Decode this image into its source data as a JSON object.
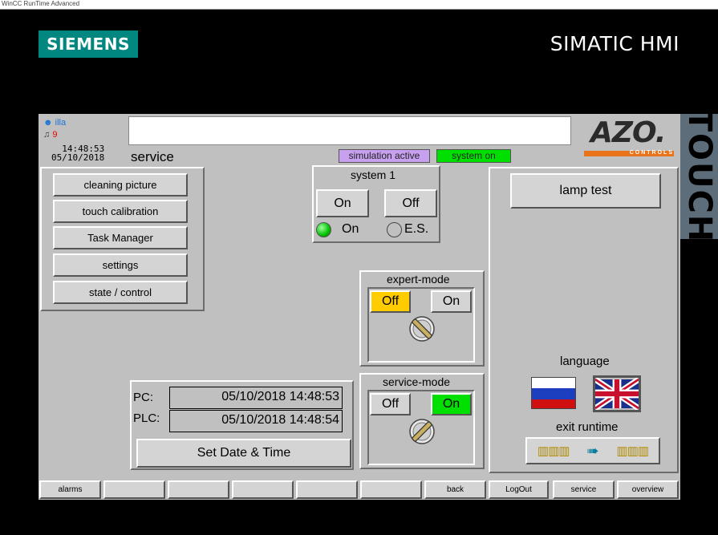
{
  "window": {
    "title_strip": "WinCC RunTime Advanced"
  },
  "brand": {
    "left_logo": "SIEMENS",
    "right_title": "SIMATIC HMI",
    "side_tab": "TOUCH"
  },
  "header": {
    "user": "illa",
    "alarm_count": "9",
    "time": "14:48:53",
    "date": "05/10/2018",
    "page_title": "service",
    "status_simulation": "simulation active",
    "status_system": "system on",
    "logo_text": "AZO.",
    "logo_sub": "CONTROLS"
  },
  "menu": {
    "items": [
      "cleaning picture",
      "touch calibration",
      "Task Manager",
      "settings",
      "state / control"
    ]
  },
  "system": {
    "title": "system 1",
    "on_label": "On",
    "off_label": "Off",
    "status_on": "On",
    "status_es": "E.S."
  },
  "expert_mode": {
    "title": "expert-mode",
    "off_label": "Off",
    "on_label": "On"
  },
  "service_mode": {
    "title": "service-mode",
    "off_label": "Off",
    "on_label": "On"
  },
  "datetime": {
    "pc_label": "PC:",
    "pc_value": "05/10/2018 14:48:53",
    "plc_label": "PLC:",
    "plc_value": "05/10/2018 14:48:54",
    "set_button": "Set Date & Time"
  },
  "right_panel": {
    "lamp_test": "lamp test",
    "language_label": "language",
    "exit_label": "exit runtime"
  },
  "bottom_nav": [
    "alarms",
    "",
    "",
    "",
    "",
    "",
    "back",
    "LogOut",
    "service",
    "overview"
  ],
  "colors": {
    "siemens_teal": "#00877f",
    "status_purple": "#c8a0f0",
    "status_green": "#00e000",
    "active_yellow": "#ffcc00",
    "azo_orange": "#e8731a"
  }
}
